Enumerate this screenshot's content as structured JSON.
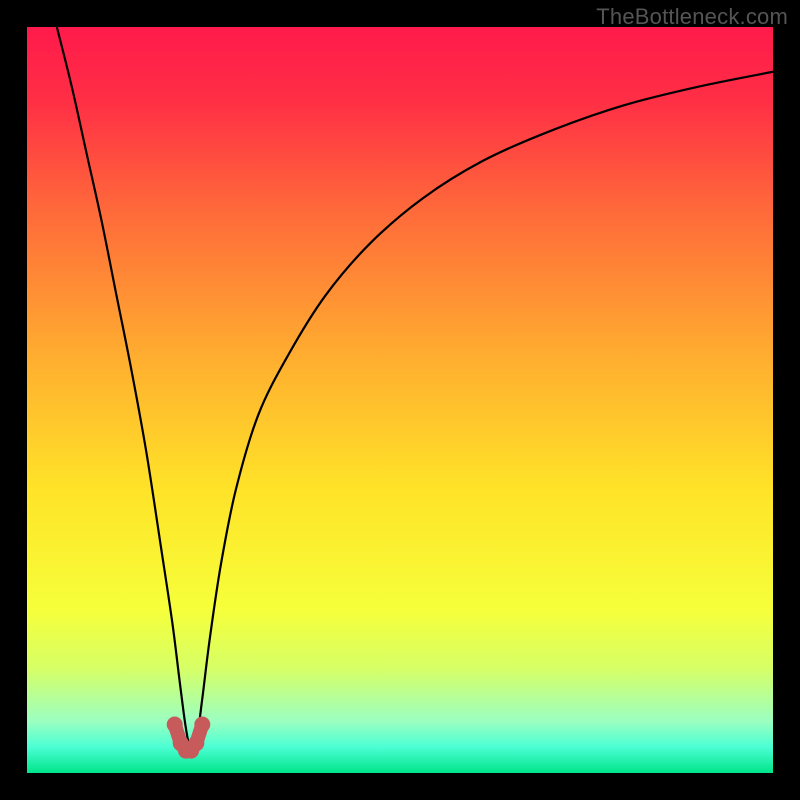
{
  "watermark": "TheBottleneck.com",
  "chart_data": {
    "type": "line",
    "title": "",
    "xlabel": "",
    "ylabel": "",
    "xlim": [
      0,
      100
    ],
    "ylim": [
      0,
      100
    ],
    "background_gradient": {
      "stops": [
        {
          "pos": 0.0,
          "color": "#ff1a4b"
        },
        {
          "pos": 0.1,
          "color": "#ff2f45"
        },
        {
          "pos": 0.25,
          "color": "#ff6b3a"
        },
        {
          "pos": 0.45,
          "color": "#ffb02f"
        },
        {
          "pos": 0.62,
          "color": "#ffe328"
        },
        {
          "pos": 0.78,
          "color": "#f6ff3a"
        },
        {
          "pos": 0.86,
          "color": "#d6ff66"
        },
        {
          "pos": 0.93,
          "color": "#9cffc0"
        },
        {
          "pos": 0.965,
          "color": "#4cffd4"
        },
        {
          "pos": 1.0,
          "color": "#00e58a"
        }
      ]
    },
    "series": [
      {
        "name": "bottleneck-curve",
        "x": [
          4,
          6,
          8,
          10,
          12,
          14,
          16,
          18,
          19.5,
          20.5,
          21.3,
          22.0,
          22.8,
          23.5,
          24.5,
          26,
          28,
          31,
          35,
          40,
          46,
          53,
          61,
          70,
          80,
          90,
          100
        ],
        "y": [
          100,
          92,
          83,
          74,
          64,
          54,
          43,
          30,
          20,
          12,
          6,
          3,
          5,
          10,
          18,
          28,
          38,
          48,
          56,
          64,
          71,
          77,
          82,
          86,
          89.5,
          92,
          94
        ]
      }
    ],
    "markers": {
      "name": "valley-markers",
      "color": "#c75a5a",
      "points": [
        {
          "x": 19.8,
          "y": 6.5
        },
        {
          "x": 20.6,
          "y": 4.0
        },
        {
          "x": 21.3,
          "y": 3.0
        },
        {
          "x": 22.0,
          "y": 3.0
        },
        {
          "x": 22.7,
          "y": 4.0
        },
        {
          "x": 23.5,
          "y": 6.5
        }
      ]
    }
  }
}
